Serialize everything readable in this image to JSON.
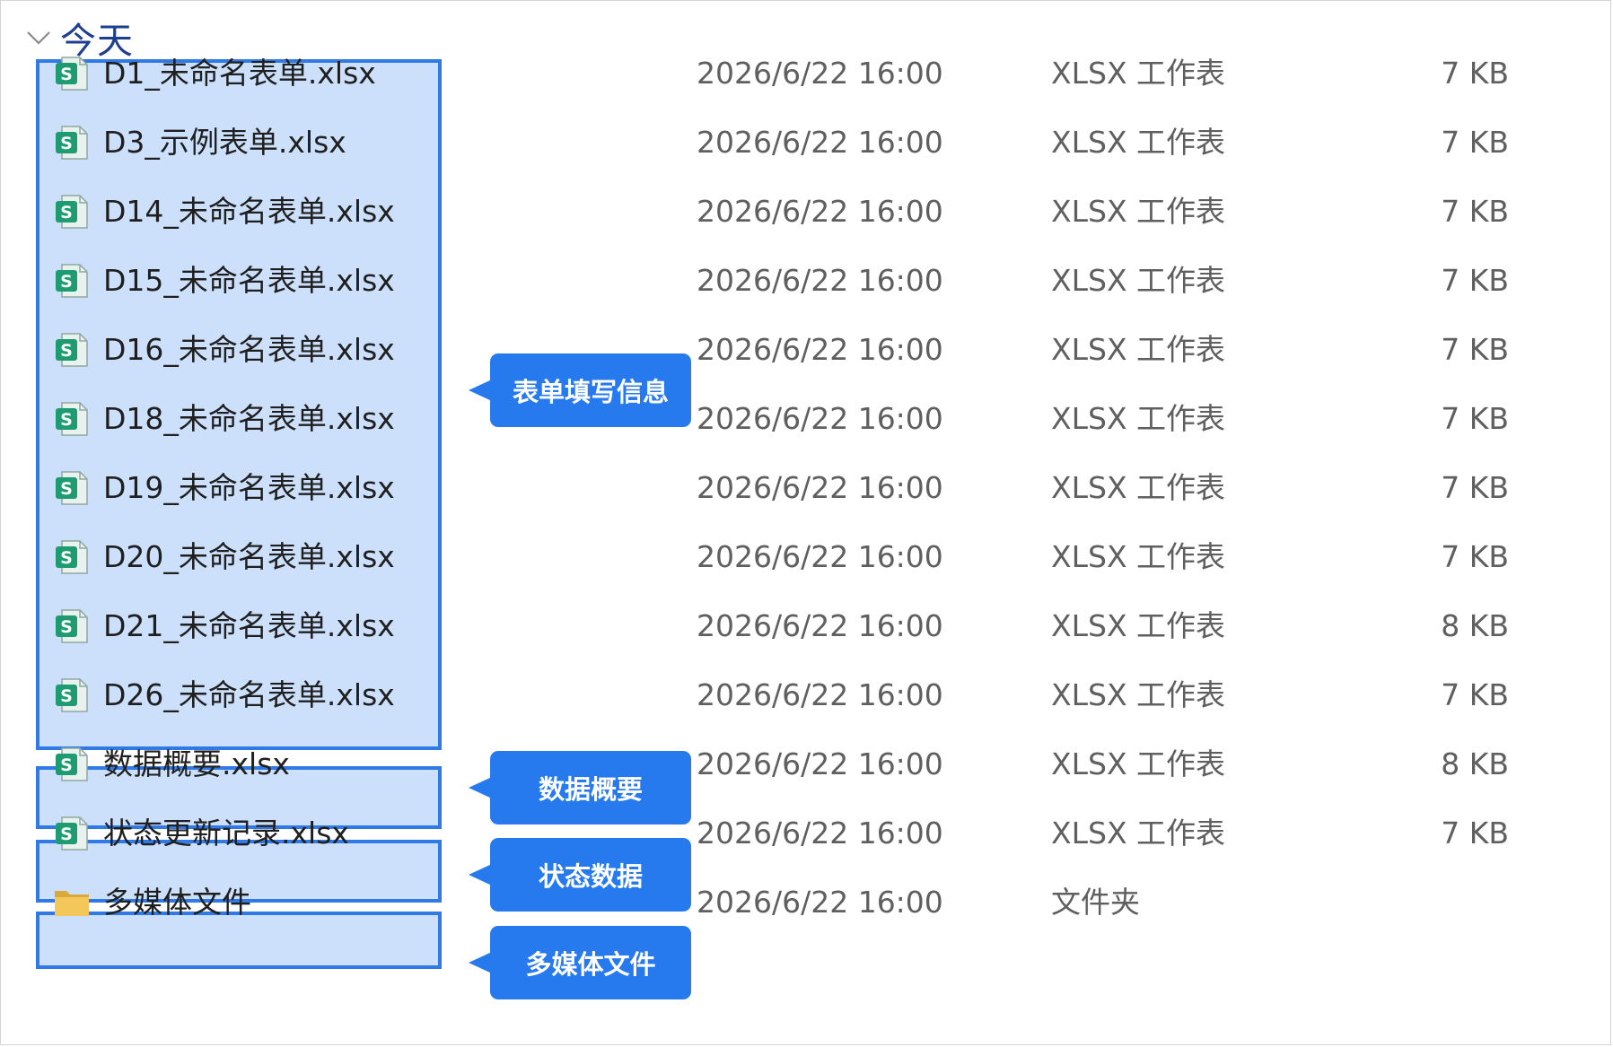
{
  "group": {
    "title": "今天",
    "icon": "chevron-down-icon"
  },
  "colors": {
    "selection_fill": "#cce0fb",
    "selection_border": "#2f7ae6",
    "callout": "#2779ee",
    "group_title": "#1e3f8f"
  },
  "files": [
    {
      "name": "D1_未命名表单.xlsx",
      "date": "2026/6/22 16:00",
      "type": "XLSX 工作表",
      "size": "7 KB",
      "icon": "spreadsheet-file-icon"
    },
    {
      "name": "D3_示例表单.xlsx",
      "date": "2026/6/22 16:00",
      "type": "XLSX 工作表",
      "size": "7 KB",
      "icon": "spreadsheet-file-icon"
    },
    {
      "name": "D14_未命名表单.xlsx",
      "date": "2026/6/22 16:00",
      "type": "XLSX 工作表",
      "size": "7 KB",
      "icon": "spreadsheet-file-icon"
    },
    {
      "name": "D15_未命名表单.xlsx",
      "date": "2026/6/22 16:00",
      "type": "XLSX 工作表",
      "size": "7 KB",
      "icon": "spreadsheet-file-icon"
    },
    {
      "name": "D16_未命名表单.xlsx",
      "date": "2026/6/22 16:00",
      "type": "XLSX 工作表",
      "size": "7 KB",
      "icon": "spreadsheet-file-icon"
    },
    {
      "name": "D18_未命名表单.xlsx",
      "date": "2026/6/22 16:00",
      "type": "XLSX 工作表",
      "size": "7 KB",
      "icon": "spreadsheet-file-icon"
    },
    {
      "name": "D19_未命名表单.xlsx",
      "date": "2026/6/22 16:00",
      "type": "XLSX 工作表",
      "size": "7 KB",
      "icon": "spreadsheet-file-icon"
    },
    {
      "name": "D20_未命名表单.xlsx",
      "date": "2026/6/22 16:00",
      "type": "XLSX 工作表",
      "size": "7 KB",
      "icon": "spreadsheet-file-icon"
    },
    {
      "name": "D21_未命名表单.xlsx",
      "date": "2026/6/22 16:00",
      "type": "XLSX 工作表",
      "size": "8 KB",
      "icon": "spreadsheet-file-icon"
    },
    {
      "name": "D26_未命名表单.xlsx",
      "date": "2026/6/22 16:00",
      "type": "XLSX 工作表",
      "size": "7 KB",
      "icon": "spreadsheet-file-icon"
    },
    {
      "name": "数据概要.xlsx",
      "date": "2026/6/22 16:00",
      "type": "XLSX 工作表",
      "size": "8 KB",
      "icon": "spreadsheet-file-icon"
    },
    {
      "name": "状态更新记录.xlsx",
      "date": "2026/6/22 16:00",
      "type": "XLSX 工作表",
      "size": "7 KB",
      "icon": "spreadsheet-file-icon"
    },
    {
      "name": "多媒体文件",
      "date": "2026/6/22 16:00",
      "type": "文件夹",
      "size": "",
      "icon": "folder-icon"
    }
  ],
  "callouts": [
    {
      "label": "表单填写信息"
    },
    {
      "label": "数据概要"
    },
    {
      "label": "状态数据"
    },
    {
      "label": "多媒体文件"
    }
  ]
}
